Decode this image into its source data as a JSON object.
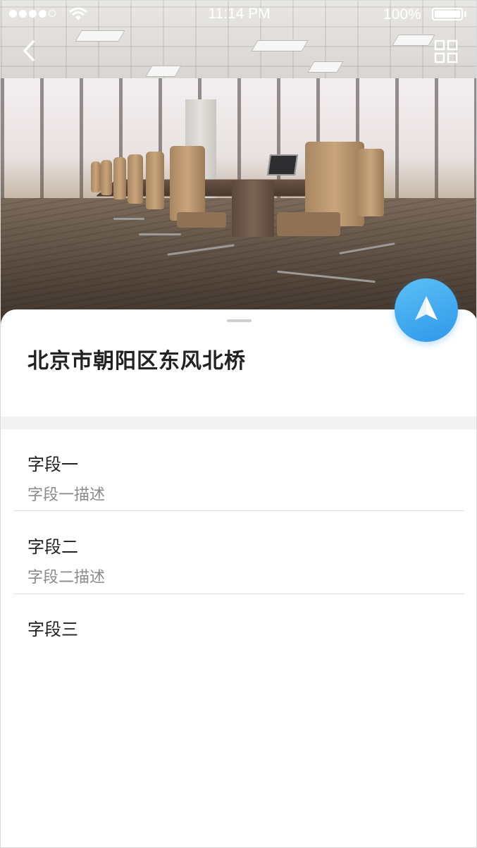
{
  "status_bar": {
    "time": "11:14 PM",
    "battery": "100%"
  },
  "header": {
    "back_icon": "chevron-left-icon",
    "grid_icon": "grid-icon"
  },
  "location": {
    "address": "北京市朝阳区东风北桥"
  },
  "fields": [
    {
      "label": "字段一",
      "description": "字段一描述"
    },
    {
      "label": "字段二",
      "description": "字段二描述"
    },
    {
      "label": "字段三"
    }
  ],
  "colors": {
    "accent": "#3aa6ee",
    "text": "#222222",
    "secondary_text": "#8a8a8a"
  }
}
